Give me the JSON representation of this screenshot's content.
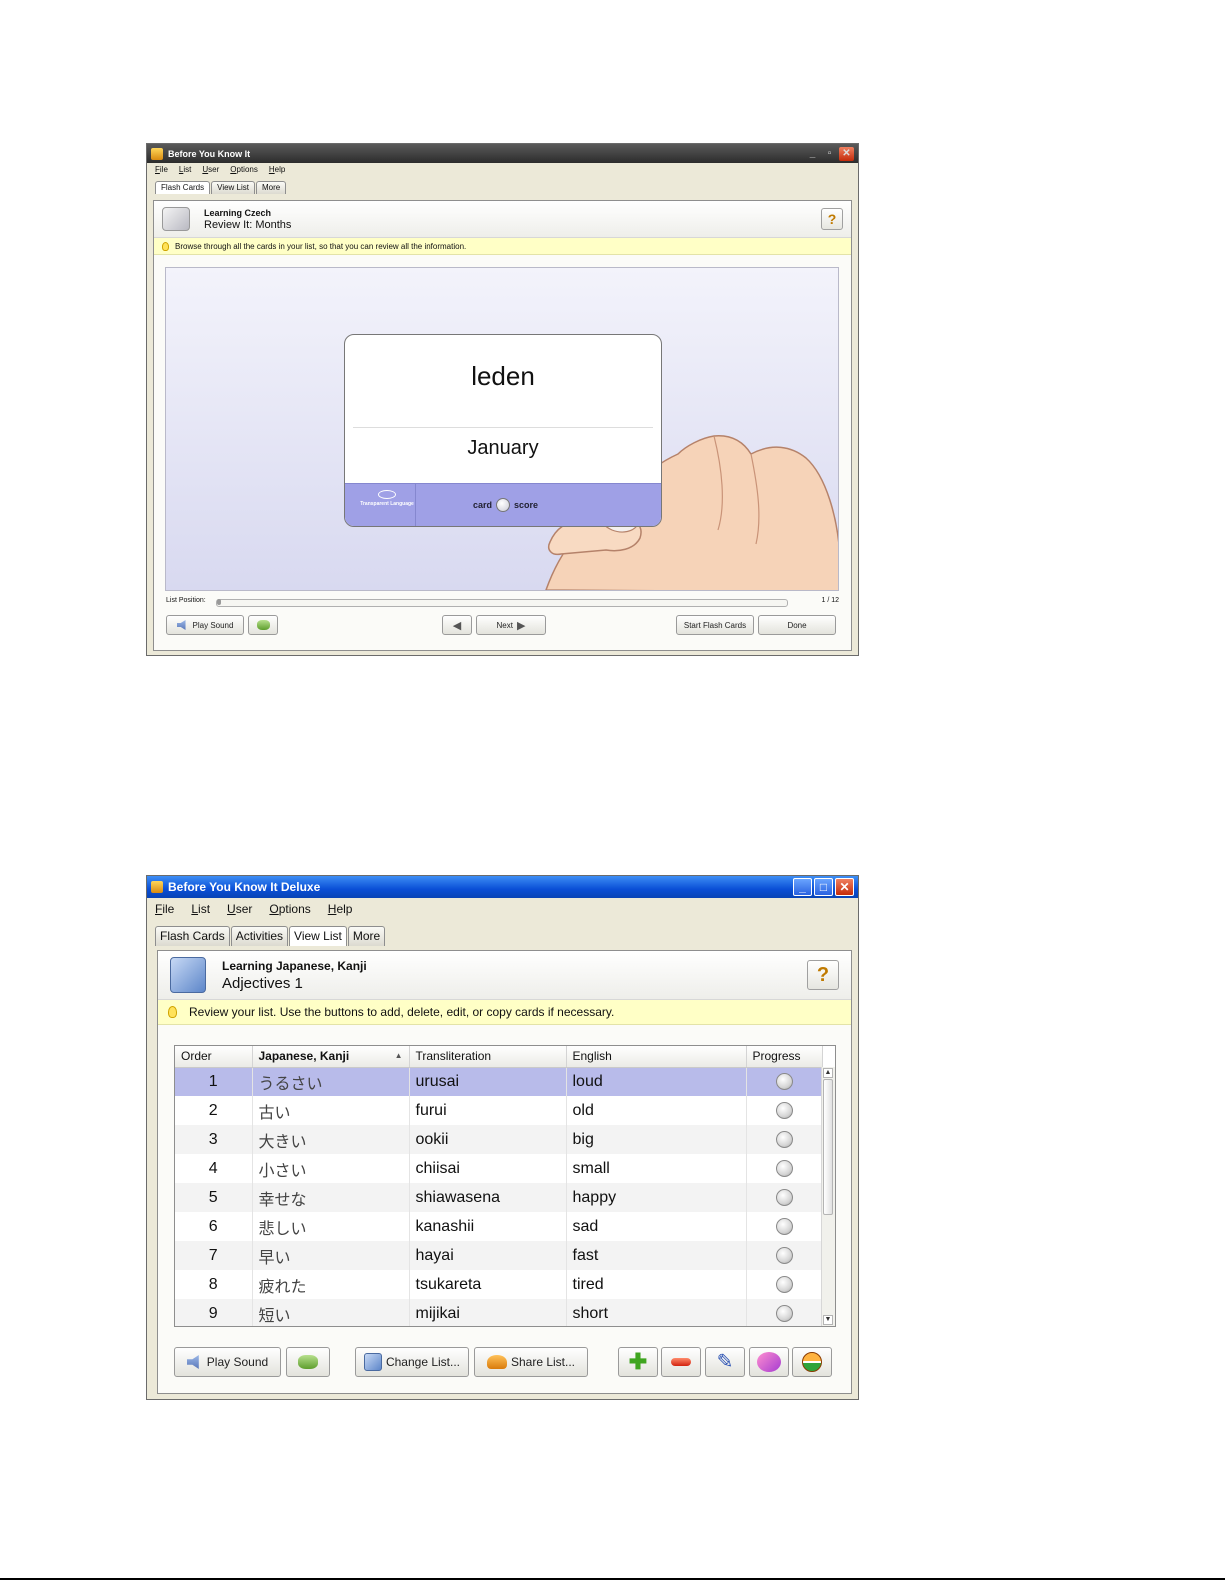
{
  "window1": {
    "title": "Before You Know It",
    "menu": [
      "File",
      "List",
      "User",
      "Options",
      "Help"
    ],
    "tabs": [
      {
        "label": "Flash Cards",
        "active": true
      },
      {
        "label": "View List",
        "active": false
      },
      {
        "label": "More",
        "active": false
      }
    ],
    "header": {
      "subtitle": "Learning Czech",
      "title": "Review It: Months"
    },
    "tip": "Browse through all the cards in your list, so that you can review all the information.",
    "card": {
      "front": "leden",
      "back": "January",
      "logo_text": "Transparent Language",
      "toggle_left": "card",
      "toggle_right": "score"
    },
    "list_position": {
      "label": "List Position:",
      "value": "1 / 12",
      "current": 1,
      "total": 12
    },
    "buttons": {
      "play_sound": "Play Sound",
      "next": "Next",
      "start_flash_cards": "Start Flash Cards",
      "done": "Done"
    }
  },
  "window2": {
    "title": "Before You Know It Deluxe",
    "menu": [
      "File",
      "List",
      "User",
      "Options",
      "Help"
    ],
    "tabs": [
      {
        "label": "Flash Cards",
        "active": false
      },
      {
        "label": "Activities",
        "active": false
      },
      {
        "label": "View List",
        "active": true
      },
      {
        "label": "More",
        "active": false
      }
    ],
    "header": {
      "subtitle": "Learning Japanese, Kanji",
      "title": "Adjectives 1"
    },
    "tip": "Review your list. Use the buttons to add, delete, edit, or copy cards if necessary.",
    "columns": [
      "Order",
      "Japanese, Kanji",
      "Transliteration",
      "English",
      "Progress"
    ],
    "sort_column": "Japanese, Kanji",
    "rows": [
      {
        "order": "1",
        "japanese": "うるさい",
        "translit": "urusai",
        "english": "loud"
      },
      {
        "order": "2",
        "japanese": "古い",
        "translit": "furui",
        "english": "old"
      },
      {
        "order": "3",
        "japanese": "大きい",
        "translit": "ookii",
        "english": "big"
      },
      {
        "order": "4",
        "japanese": "小さい",
        "translit": "chiisai",
        "english": "small"
      },
      {
        "order": "5",
        "japanese": "幸せな",
        "translit": "shiawasena",
        "english": "happy"
      },
      {
        "order": "6",
        "japanese": "悲しい",
        "translit": "kanashii",
        "english": "sad"
      },
      {
        "order": "7",
        "japanese": "早い",
        "translit": "hayai",
        "english": "fast"
      },
      {
        "order": "8",
        "japanese": "疲れた",
        "translit": "tsukareta",
        "english": "tired"
      },
      {
        "order": "9",
        "japanese": "短い",
        "translit": "mijikai",
        "english": "short"
      }
    ],
    "selected_row": 1,
    "buttons": {
      "play_sound": "Play Sound",
      "change_list": "Change List...",
      "share_list": "Share List..."
    },
    "action_icons": [
      "add-icon",
      "delete-icon",
      "edit-icon",
      "copy-icon",
      "stop-icon"
    ]
  },
  "colors": {
    "xp_title_blue": "#0a4fd6",
    "selected_row": "#b8bbea",
    "card_footer": "#9fa0e6",
    "tip_yellow": "#ffffc6"
  }
}
